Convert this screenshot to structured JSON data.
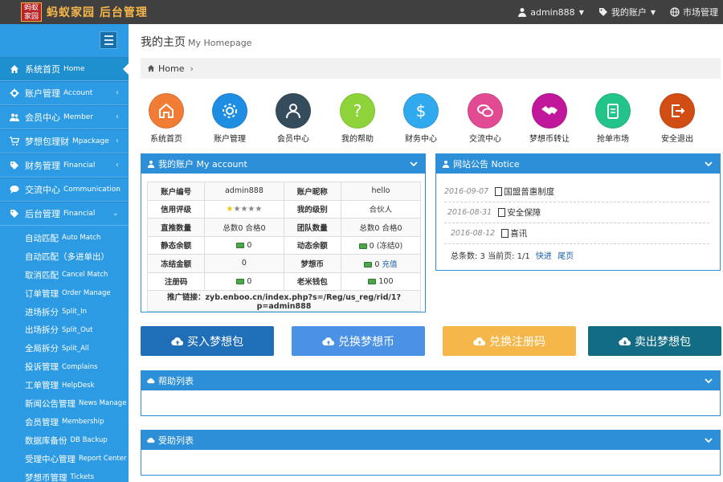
{
  "header": {
    "logo_mark": "蚂蚁家园",
    "logo_text": "蚂蚁家园  后台管理",
    "user": "admin888",
    "my_account": "我的账户",
    "market": "市场管理"
  },
  "sidebar": {
    "items": [
      {
        "label": "系统首页",
        "en": "Home",
        "icon": "home-icon",
        "active": true
      },
      {
        "label": "账户管理",
        "en": "Account",
        "icon": "gear-icon"
      },
      {
        "label": "会员中心",
        "en": "Member",
        "icon": "users-icon"
      },
      {
        "label": "梦想包理财",
        "en": "Mpackage",
        "icon": "cart-icon"
      },
      {
        "label": "财务管理",
        "en": "Financial",
        "icon": "tag-icon"
      },
      {
        "label": "交流中心",
        "en": "Communication",
        "icon": "chat-icon"
      },
      {
        "label": "后台管理",
        "en": "Financial",
        "icon": "tag-icon",
        "expanded": true
      }
    ],
    "subitems": [
      {
        "label": "自动匹配",
        "en": "Auto Match"
      },
      {
        "label": "自动匹配（多进单出）",
        "en": ""
      },
      {
        "label": "取消匹配",
        "en": "Cancel Match"
      },
      {
        "label": "订单管理",
        "en": "Order Manage"
      },
      {
        "label": "进场拆分",
        "en": "Split_In"
      },
      {
        "label": "出场拆分",
        "en": "Split_Out"
      },
      {
        "label": "全局拆分",
        "en": "Split_All"
      },
      {
        "label": "投诉管理",
        "en": "Complains"
      },
      {
        "label": "工单管理",
        "en": "HelpDesk"
      },
      {
        "label": "新闻公告管理",
        "en": "News Manage"
      },
      {
        "label": "会员管理",
        "en": "Membership"
      },
      {
        "label": "数据库备份",
        "en": "DB Backup"
      },
      {
        "label": "受理中心管理",
        "en": "Report Center"
      },
      {
        "label": "梦想币管理",
        "en": "Tickets"
      }
    ]
  },
  "main": {
    "title": "我的主页",
    "title_en": "My Homepage",
    "breadcrumb": "Home",
    "shortcuts": [
      {
        "label": "系统首页",
        "color": "#f07c35",
        "icon": "home-icon"
      },
      {
        "label": "账户管理",
        "color": "#1e8ee3",
        "icon": "gear-icon"
      },
      {
        "label": "会员中心",
        "color": "#354c5c",
        "icon": "user-icon"
      },
      {
        "label": "我的帮助",
        "color": "#8fd33a",
        "icon": "help-icon"
      },
      {
        "label": "财务中心",
        "color": "#31a9ee",
        "icon": "dollar-icon"
      },
      {
        "label": "交流中心",
        "color": "#e24a94",
        "icon": "chat-icon"
      },
      {
        "label": "梦想币转让",
        "color": "#c0179b",
        "icon": "handshake-icon"
      },
      {
        "label": "抢单市场",
        "color": "#22c48a",
        "icon": "clipboard-icon"
      },
      {
        "label": "安全退出",
        "color": "#d24d14",
        "icon": "exit-icon"
      }
    ],
    "account_panel": {
      "title": "我的账户 My account",
      "rows": [
        [
          "账户编号",
          "admin888",
          "账户昵称",
          "hello"
        ],
        [
          "信用评级",
          "",
          "我的级别",
          "合伙人"
        ],
        [
          "直推数量",
          "总数0 合格0",
          "团队数量",
          "总数0 合格0"
        ],
        [
          "静态余额",
          "0",
          "动态余额",
          "0 (冻结0)"
        ],
        [
          "冻结金额",
          "0",
          "梦想币",
          "0"
        ],
        [
          "注册码",
          "0",
          "老米钱包",
          "100"
        ]
      ],
      "recharge": "充值",
      "link_label": "推广链接：",
      "link": "zyb.enboo.cn/index.php?s=/Reg/us_reg/rid/1?p=admin888"
    },
    "notice_panel": {
      "title": "网站公告 Notice",
      "items": [
        {
          "date": "2016-09-07",
          "title": "国盟普惠制度"
        },
        {
          "date": "2016-08-31",
          "title": "安全保障"
        },
        {
          "date": "2016-08-12",
          "title": "喜讯"
        }
      ],
      "pager": "总条数: 3 当前页: 1/1",
      "first": "快进",
      "last": "尾页"
    },
    "buttons": [
      {
        "label": "买入梦想包",
        "color": "#1f6fb8"
      },
      {
        "label": "兑换梦想币",
        "color": "#4a92e6"
      },
      {
        "label": "兑换注册码",
        "color": "#f6b74a"
      },
      {
        "label": "卖出梦想包",
        "color": "#126c83"
      }
    ],
    "help_panel": {
      "title": "帮助列表"
    },
    "receive_panel": {
      "title": "受助列表"
    }
  }
}
